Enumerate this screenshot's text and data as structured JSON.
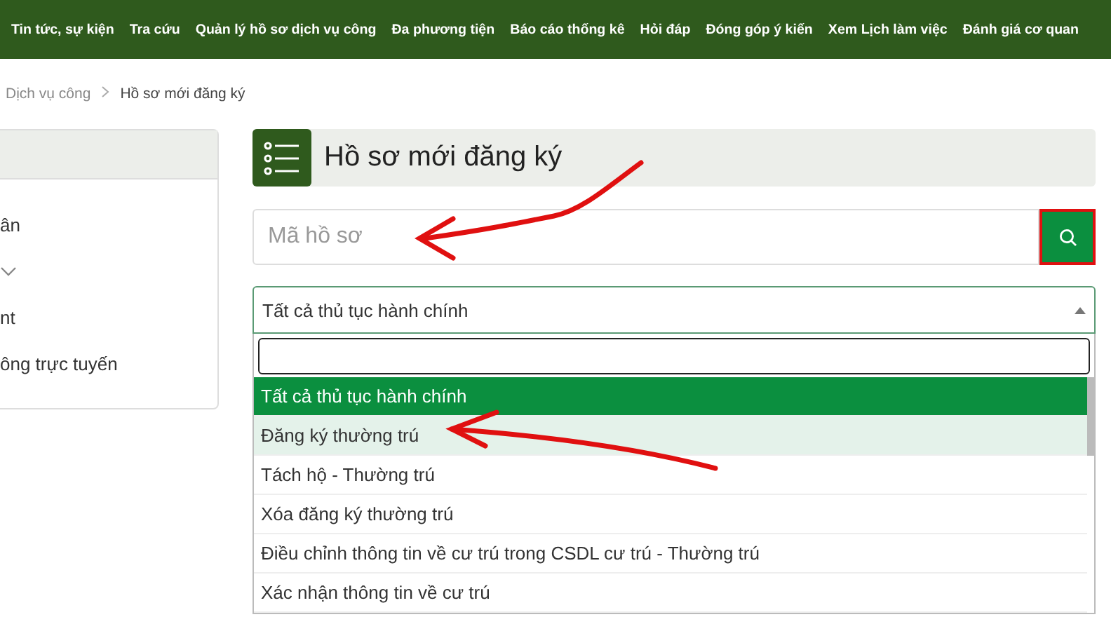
{
  "nav": {
    "items": [
      {
        "label": "Tin tức, sự kiện"
      },
      {
        "label": "Tra cứu"
      },
      {
        "label": "Quản lý hồ sơ dịch vụ công"
      },
      {
        "label": "Đa phương tiện"
      },
      {
        "label": "Báo cáo thống kê"
      },
      {
        "label": "Hỏi đáp"
      },
      {
        "label": "Đóng góp ý kiến"
      },
      {
        "label": "Xem Lịch làm việc"
      },
      {
        "label": "Đánh giá cơ quan"
      }
    ]
  },
  "breadcrumb": [
    "Dịch vụ công",
    "Hồ sơ mới đăng ký"
  ],
  "sidebar": {
    "items": [
      {
        "label": "ân"
      },
      {
        "expanded": false
      },
      {
        "label": "nt"
      },
      {
        "label": "ông trực tuyến"
      }
    ]
  },
  "panel": {
    "title": "Hồ sơ mới đăng ký",
    "search": {
      "placeholder": "Mã hồ sơ"
    },
    "select": {
      "value": "Tất cả thủ tục hành chính",
      "expanded": true,
      "options": [
        {
          "label": "Tất cả thủ tục hành chính",
          "selected": true,
          "highlighted": false
        },
        {
          "label": "Đăng ký thường trú",
          "selected": false,
          "highlighted": true
        },
        {
          "label": "Tách hộ - Thường trú",
          "selected": false,
          "highlighted": false
        },
        {
          "label": "Xóa đăng ký thường trú",
          "selected": false,
          "highlighted": false
        },
        {
          "label": "Điều chỉnh thông tin về cư trú trong CSDL cư trú - Thường trú",
          "selected": false,
          "highlighted": false
        },
        {
          "label": "Xác nhận thông tin về cư trú",
          "selected": false,
          "highlighted": false
        }
      ]
    }
  }
}
